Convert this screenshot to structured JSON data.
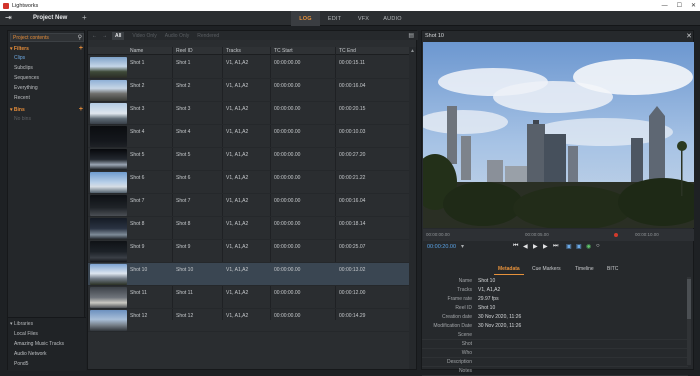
{
  "window": {
    "app_title": "Lightworks"
  },
  "topbar": {
    "project_name": "Project New",
    "tabs": [
      {
        "label": "LOG",
        "active": true
      },
      {
        "label": "EDIT",
        "active": false
      },
      {
        "label": "VFX",
        "active": false
      },
      {
        "label": "AUDIO",
        "active": false
      }
    ]
  },
  "left": {
    "project_field": "Project contents",
    "filters_head": "Filters",
    "filters": [
      "Clips",
      "Subclips",
      "Sequences",
      "Everything",
      "Recent"
    ],
    "bins_head": "Bins",
    "bins": [
      "No bins"
    ],
    "libraries_head": "Libraries",
    "libraries": [
      "Local Files",
      "Amazing Music Tracks",
      "Audio Network",
      "Pond5"
    ]
  },
  "center": {
    "filter_tabs": [
      "All",
      "Video Only",
      "Audio Only",
      "Rendered"
    ],
    "columns": [
      "Name",
      "Reel ID",
      "Tracks",
      "TC Start",
      "TC End"
    ],
    "rows": [
      {
        "name": "Shot 1",
        "reel": "Shot 1",
        "tracks": "V1, A1,A2",
        "tc_start": "00:00:00.00",
        "tc_end": "00:00:15.11"
      },
      {
        "name": "Shot 2",
        "reel": "Shot 2",
        "tracks": "V1, A1,A2",
        "tc_start": "00:00:00.00",
        "tc_end": "00:00:16.04"
      },
      {
        "name": "Shot 3",
        "reel": "Shot 3",
        "tracks": "V1, A1,A2",
        "tc_start": "00:00:00.00",
        "tc_end": "00:00:20.15"
      },
      {
        "name": "Shot 4",
        "reel": "Shot 4",
        "tracks": "V1, A1,A2",
        "tc_start": "00:00:00.00",
        "tc_end": "00:00:10.03"
      },
      {
        "name": "Shot 5",
        "reel": "Shot 5",
        "tracks": "V1, A1,A2",
        "tc_start": "00:00:00.00",
        "tc_end": "00:00:27.20"
      },
      {
        "name": "Shot 6",
        "reel": "Shot 6",
        "tracks": "V1, A1,A2",
        "tc_start": "00:00:00.00",
        "tc_end": "00:00:21.22"
      },
      {
        "name": "Shot 7",
        "reel": "Shot 7",
        "tracks": "V1, A1,A2",
        "tc_start": "00:00:00.00",
        "tc_end": "00:00:16.04"
      },
      {
        "name": "Shot 8",
        "reel": "Shot 8",
        "tracks": "V1, A1,A2",
        "tc_start": "00:00:00.00",
        "tc_end": "00:00:18.14"
      },
      {
        "name": "Shot 9",
        "reel": "Shot 9",
        "tracks": "V1, A1,A2",
        "tc_start": "00:00:00.00",
        "tc_end": "00:00:25.07"
      },
      {
        "name": "Shot 10",
        "reel": "Shot 10",
        "tracks": "V1, A1,A2",
        "tc_start": "00:00:00.00",
        "tc_end": "00:00:13.02"
      },
      {
        "name": "Shot 11",
        "reel": "Shot 11",
        "tracks": "V1, A1,A2",
        "tc_start": "00:00:00.00",
        "tc_end": "00:00:12.00"
      },
      {
        "name": "Shot 12",
        "reel": "Shot 12",
        "tracks": "V1, A1,A2",
        "tc_start": "00:00:00.00",
        "tc_end": "00:00:14.29"
      }
    ]
  },
  "viewer": {
    "title": "Shot 10",
    "ruler": [
      "00:00:00.00",
      "00:00:05.00",
      "00:00:10.00"
    ],
    "current_tc": "00:00:20.00",
    "meta_tabs": [
      "Metadata",
      "Cue Markers",
      "Timeline",
      "BITC"
    ],
    "metadata": [
      {
        "k": "Name",
        "v": "Shot 10"
      },
      {
        "k": "Tracks",
        "v": "V1, A1,A2"
      },
      {
        "k": "Frame rate",
        "v": "29.97 fps"
      },
      {
        "k": "Reel ID",
        "v": "Shot 10"
      },
      {
        "k": "Creation date",
        "v": "30 Nov 2020, 11:26"
      },
      {
        "k": "Modification Date",
        "v": "30 Nov 2020, 11:26"
      },
      {
        "k": "Scene",
        "v": ""
      },
      {
        "k": "Shot",
        "v": ""
      },
      {
        "k": "Who",
        "v": ""
      },
      {
        "k": "Description",
        "v": ""
      },
      {
        "k": "Notes",
        "v": ""
      }
    ]
  },
  "colors": {
    "accent": "#e6913b",
    "selection": "#3a4652",
    "timecode": "#5aa3e6"
  }
}
